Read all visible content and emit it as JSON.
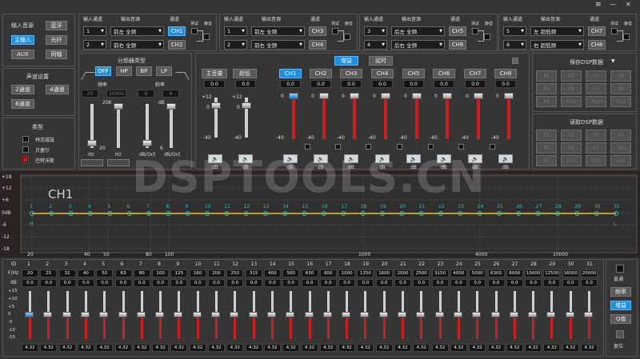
{
  "window": {
    "menu": "≡",
    "minimize": "—",
    "close": "✕"
  },
  "input_source": {
    "title": "输入音源",
    "buttons": [
      "蓝牙",
      "主输入",
      "光纤",
      "AUX",
      "同轴"
    ],
    "active": "主输入"
  },
  "routing": [
    {
      "in_label": "输入通道",
      "out_label": "输出音源",
      "ch_label": "通道",
      "test": "测试",
      "mute": "静音",
      "rows": [
        {
          "num": "1",
          "src": "前左 全频",
          "ch": "CH1",
          "active": true
        },
        {
          "num": "2",
          "src": "前右 全频",
          "ch": "CH2",
          "active": false
        }
      ]
    },
    {
      "in_label": "输入通道",
      "out_label": "输出音源",
      "ch_label": "通道",
      "test": "测试",
      "mute": "静音",
      "rows": [
        {
          "num": "1",
          "src": "前左 全频",
          "ch": "CH3",
          "active": false
        },
        {
          "num": "2",
          "src": "前右 全频",
          "ch": "CH4",
          "active": false
        }
      ]
    },
    {
      "in_label": "输入通道",
      "out_label": "输出音源",
      "ch_label": "通道",
      "test": "测试",
      "mute": "静音",
      "rows": [
        {
          "num": "3",
          "src": "后左 全频",
          "ch": "CH5",
          "active": false
        },
        {
          "num": "4",
          "src": "后右 全频",
          "ch": "CH6",
          "active": false
        }
      ]
    },
    {
      "in_label": "输入通道",
      "out_label": "输出音源",
      "ch_label": "通道",
      "test": "测试",
      "mute": "静音",
      "rows": [
        {
          "num": "5",
          "src": "左 超低频",
          "ch": "CH7",
          "active": false
        },
        {
          "num": "6",
          "src": "右 超低频",
          "ch": "CH8",
          "active": false
        }
      ]
    }
  ],
  "channel_settings": {
    "title": "声道设置",
    "buttons": [
      "2通道",
      "4通道",
      "6通道"
    ]
  },
  "filter_type": {
    "title": "类型",
    "options": [
      "林克威兹",
      "贝塞尔",
      "巴特沃斯"
    ],
    "selected": "巴特沃斯"
  },
  "crossover": {
    "title": "分频器类型",
    "modes": [
      "OFF",
      "HP",
      "BP",
      "LP"
    ],
    "active": "OFF",
    "freq_label": "频率",
    "slope_label": "斜率",
    "values": [
      "20",
      "20000",
      "6",
      "6"
    ],
    "freq_top": "20K",
    "slope_top": "dB",
    "hz1": "Hz",
    "hz2": "Hz",
    "oct1": "dB/Oct",
    "oct2": "dB/Oct",
    "slider_min_left": "20",
    "slider_min_right": "6"
  },
  "gain_mixer": {
    "master_label": "主音量",
    "bass_label": "超低",
    "master_val": "0.0",
    "bass_val": "0.0",
    "tabs": [
      "增益",
      "延时"
    ],
    "active_tab": "增益",
    "channels": [
      "CH1",
      "CH2",
      "CH3",
      "CH4",
      "CH5",
      "CH6",
      "CH7",
      "CH8"
    ],
    "active_channel": "CH1",
    "channel_vals": [
      "0.0",
      "0.0",
      "0.0",
      "0.0",
      "0.0",
      "0.0",
      "0.0",
      "0.0"
    ],
    "scale_master": [
      "+12",
      "0",
      "-40"
    ],
    "scale_ch": [
      "0",
      "-40"
    ],
    "db": "dB",
    "speaker_icon": "speaker-icon"
  },
  "presets": {
    "save_title": "保存DSP数据",
    "load_title": "读取DSP数据",
    "save_items": [
      "F1",
      "F2",
      "F3",
      "F4",
      "F5",
      "F6",
      "F7",
      "F8",
      "F9",
      "F10",
      "F11",
      "F12"
    ],
    "load_items": [
      "F1",
      "F2",
      "F3",
      "F4",
      "F5",
      "F6",
      "F7",
      "F8",
      "F9",
      "F10",
      "F11",
      "F12"
    ]
  },
  "graph": {
    "channel_title": "CH1",
    "y_ticks": [
      "+18",
      "+12",
      "+6",
      "0dB",
      "-6",
      "-12",
      "-18"
    ],
    "x_ticks": [
      "20",
      "40",
      "50",
      "80",
      "100",
      "1000",
      "4000",
      "10000"
    ],
    "point_labels": [
      "1",
      "2",
      "3",
      "4",
      "5",
      "6",
      "7",
      "8",
      "9",
      "10",
      "11",
      "12",
      "13",
      "14",
      "15",
      "16",
      "17",
      "18",
      "19",
      "20",
      "21",
      "22",
      "23",
      "24",
      "25",
      "26",
      "27",
      "28",
      "29",
      "30",
      "31"
    ],
    "h_label": "H",
    "l_label": "L",
    "line_color": "#f0c020",
    "point_color": "#2ac0c8"
  },
  "eq": {
    "id_label": "ID",
    "fhz_label": "F/Hz",
    "db_label": "dB",
    "ids": [
      "1",
      "2",
      "3",
      "4",
      "5",
      "6",
      "7",
      "8",
      "9",
      "10",
      "11",
      "12",
      "13",
      "14",
      "15",
      "16",
      "17",
      "18",
      "19",
      "20",
      "21",
      "22",
      "23",
      "24",
      "25",
      "26",
      "27",
      "28",
      "29",
      "30",
      "31"
    ],
    "freqs": [
      "20",
      "25",
      "31",
      "40",
      "50",
      "63",
      "80",
      "100",
      "125",
      "160",
      "200",
      "250",
      "315",
      "400",
      "500",
      "630",
      "800",
      "1000",
      "1250",
      "1600",
      "2000",
      "2500",
      "3150",
      "4000",
      "5000",
      "6300",
      "8000",
      "10000",
      "12500",
      "16000",
      "20000"
    ],
    "dbs": [
      "0.0",
      "0.0",
      "0.0",
      "0.0",
      "0.0",
      "0.0",
      "0.0",
      "0.0",
      "0.0",
      "0.0",
      "0.0",
      "0.0",
      "0.0",
      "0.0",
      "0.0",
      "0.0",
      "0.0",
      "0.0",
      "0.0",
      "0.0",
      "0.0",
      "0.0",
      "0.0",
      "0.0",
      "0.0",
      "0.0",
      "0.0",
      "0.0",
      "0.0",
      "0.0",
      "0.0"
    ],
    "q_vals": [
      "4.32",
      "4.32",
      "4.32",
      "4.32",
      "4.32",
      "4.32",
      "4.32",
      "4.32",
      "4.32",
      "4.32",
      "4.32",
      "4.32",
      "4.32",
      "4.32",
      "4.32",
      "4.32",
      "4.32",
      "4.32",
      "4.32",
      "4.32",
      "4.32",
      "4.32",
      "4.32",
      "4.32",
      "4.32",
      "4.32",
      "4.32",
      "4.32",
      "4.32",
      "4.32",
      "4.32"
    ],
    "scale": [
      "+15",
      "+10",
      "+5",
      "0",
      "-5",
      "-10",
      "-15"
    ]
  },
  "eq_side": {
    "bypass": "直通",
    "freq": "频率",
    "gain": "增益",
    "q": "Q值",
    "reset": "复位",
    "active": "增益"
  },
  "watermark": "DSPTOOLS.CN"
}
